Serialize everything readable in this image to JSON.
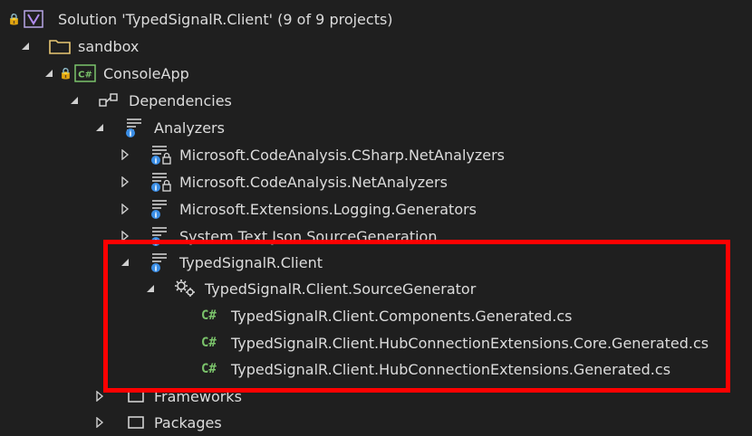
{
  "solution": {
    "label": "Solution 'TypedSignalR.Client' (9 of 9 projects)"
  },
  "tree": {
    "sandbox": "sandbox",
    "console_app": "ConsoleApp",
    "dependencies": "Dependencies",
    "analyzers": "Analyzers",
    "analyzer_items": [
      "Microsoft.CodeAnalysis.CSharp.NetAnalyzers",
      "Microsoft.CodeAnalysis.NetAnalyzers",
      "Microsoft.Extensions.Logging.Generators",
      "System.Text.Json.SourceGeneration"
    ],
    "typed_client": "TypedSignalR.Client",
    "source_generator": "TypedSignalR.Client.SourceGenerator",
    "generated_files": [
      "TypedSignalR.Client.Components.Generated.cs",
      "TypedSignalR.Client.HubConnectionExtensions.Core.Generated.cs",
      "TypedSignalR.Client.HubConnectionExtensions.Generated.cs"
    ],
    "frameworks": "Frameworks",
    "packages": "Packages"
  },
  "icons": {
    "lock": "lock-icon",
    "solution": "visual-studio-solution-icon",
    "folder": "folder-icon",
    "csproj": "csharp-project-icon",
    "dependencies": "dependencies-icon",
    "analyzer": "analyzer-icon",
    "generator": "gear-icon",
    "csfile": "csharp-file-icon"
  },
  "colors": {
    "background": "#1f1f1f",
    "text": "#dcdcdc",
    "highlight": "#ff0000",
    "cs_green": "#7bc46b"
  }
}
